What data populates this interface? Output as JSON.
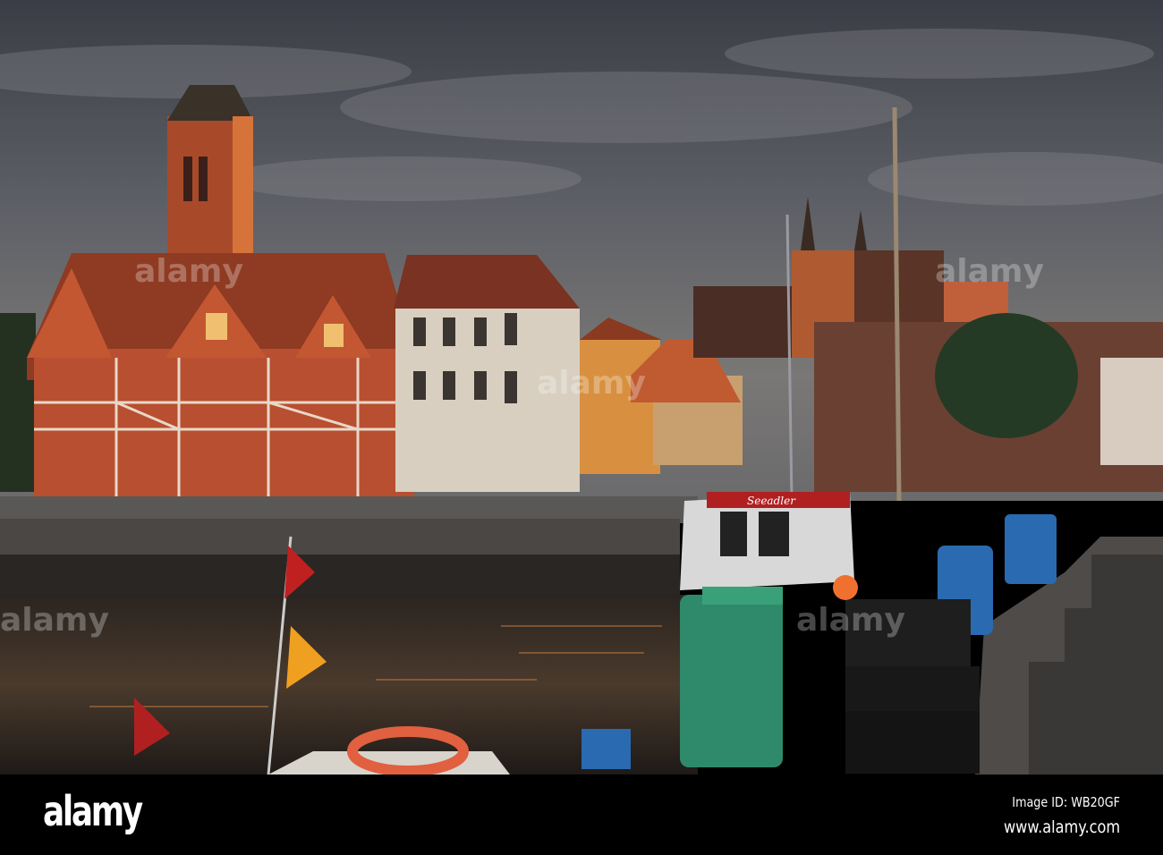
{
  "photo": {
    "boat_name": "Seeadler",
    "watermark": "alamy"
  },
  "footer": {
    "logo": "alamy",
    "image_id": "Image ID: WB20GF",
    "website": "www.alamy.com"
  }
}
